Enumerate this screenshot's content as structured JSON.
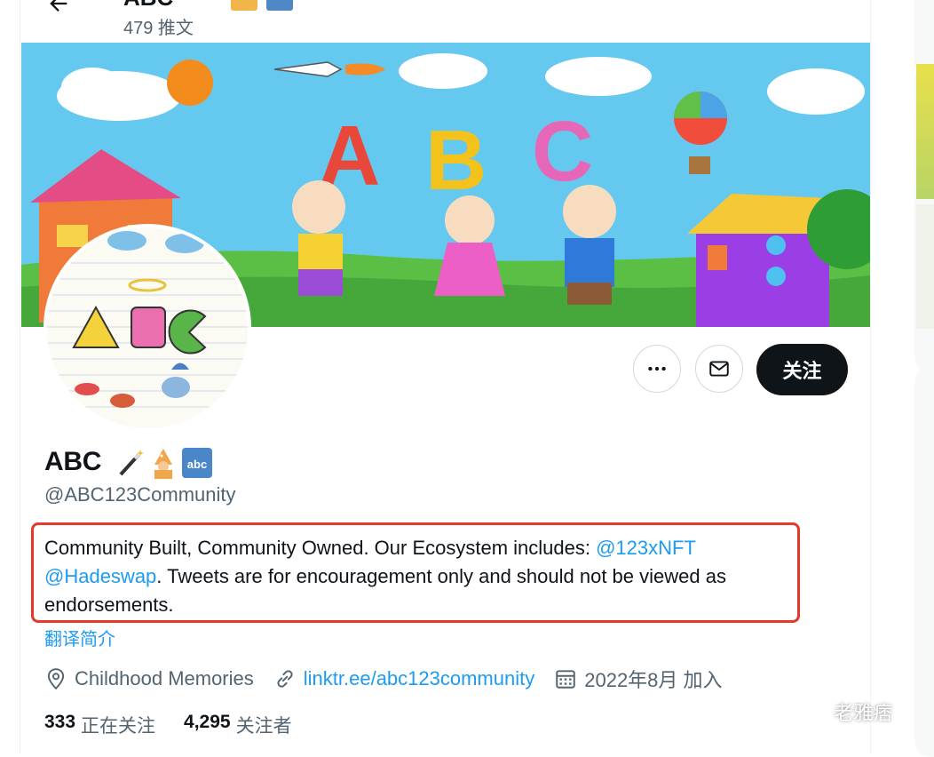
{
  "header": {
    "name": "ABC",
    "tweet_count": "479 推文"
  },
  "profile": {
    "display_name": "ABC",
    "handle": "@ABC123Community",
    "bio_part1": "Community Built, Community Owned. Our Ecosystem includes: ",
    "mention1": "@123xNFT",
    "mention2": "@Hadeswap",
    "bio_part2": ". Tweets are for encouragement only and should not be viewed as endorsements.",
    "translate_label": "翻译简介",
    "location": "Childhood Memories",
    "website": "linktr.ee/abc123community",
    "joined": "2022年8月 加入",
    "following_count": "333",
    "following_label": "正在关注",
    "followers_count": "4,295",
    "followers_label": "关注者"
  },
  "actions": {
    "follow_label": "关注"
  },
  "icons": {
    "back": "arrow-left-icon",
    "more": "more-icon",
    "message": "envelope-icon",
    "location": "location-pin-icon",
    "link": "link-icon",
    "calendar": "calendar-icon"
  },
  "colors": {
    "accent": "#1d9bf0",
    "highlight_border": "#e33a2a",
    "secondary_text": "#536471"
  },
  "watermark": {
    "text": "老雅痞"
  }
}
